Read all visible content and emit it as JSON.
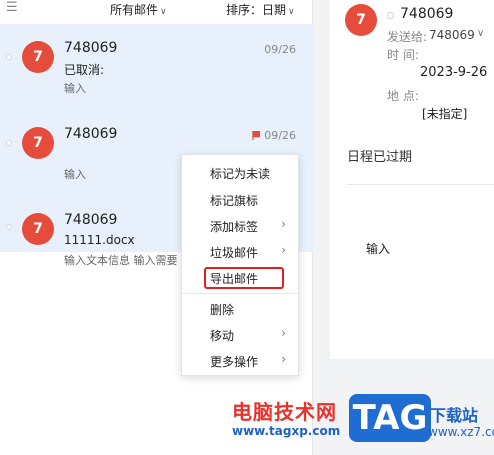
{
  "toolbar": {
    "menu_icon": "☰",
    "filter_label": "所有邮件",
    "sort_label": "排序：日期"
  },
  "mails": [
    {
      "avatar": "7",
      "sender": "748069",
      "date": "09/26",
      "subject": "已取消:",
      "preview": "输入",
      "flagged": false
    },
    {
      "avatar": "7",
      "sender": "748069",
      "date": "09/26",
      "subject": "",
      "preview": "输入",
      "flagged": true
    },
    {
      "avatar": "7",
      "sender": "748069",
      "date": "",
      "subject": "11111.docx",
      "preview": "输入文本信息 输入需要",
      "flagged": false
    }
  ],
  "context_menu": {
    "items": [
      {
        "label": "标记为未读",
        "submenu": false
      },
      {
        "label": "标记旗标",
        "submenu": false
      },
      {
        "label": "添加标签",
        "submenu": true
      },
      {
        "label": "垃圾邮件",
        "submenu": true
      },
      {
        "label": "导出邮件",
        "submenu": false
      },
      {
        "label": "删除",
        "submenu": false
      },
      {
        "label": "移动",
        "submenu": true
      },
      {
        "label": "更多操作",
        "submenu": true
      }
    ]
  },
  "detail": {
    "avatar": "7",
    "sender": "748069",
    "sent_to_label": "发送给:",
    "sent_to_value": "748069",
    "time_label": "时 间:",
    "time_value": "2023-9-26",
    "place_label": "地 点:",
    "place_value": "[未指定]",
    "expired": "日程已过期",
    "body": "输入"
  },
  "watermark": {
    "cn": "电脑技术网",
    "url": "www.tagxp.com",
    "tag": "TAG",
    "cn2": "下载站",
    "url2": "www.xz7.com"
  },
  "colors": {
    "avatar": "#e64c3c",
    "list_bg": "#e8f1fb",
    "highlight": "#e02020",
    "watermark_red": "#e8322b",
    "watermark_blue": "#1f6dd2"
  }
}
